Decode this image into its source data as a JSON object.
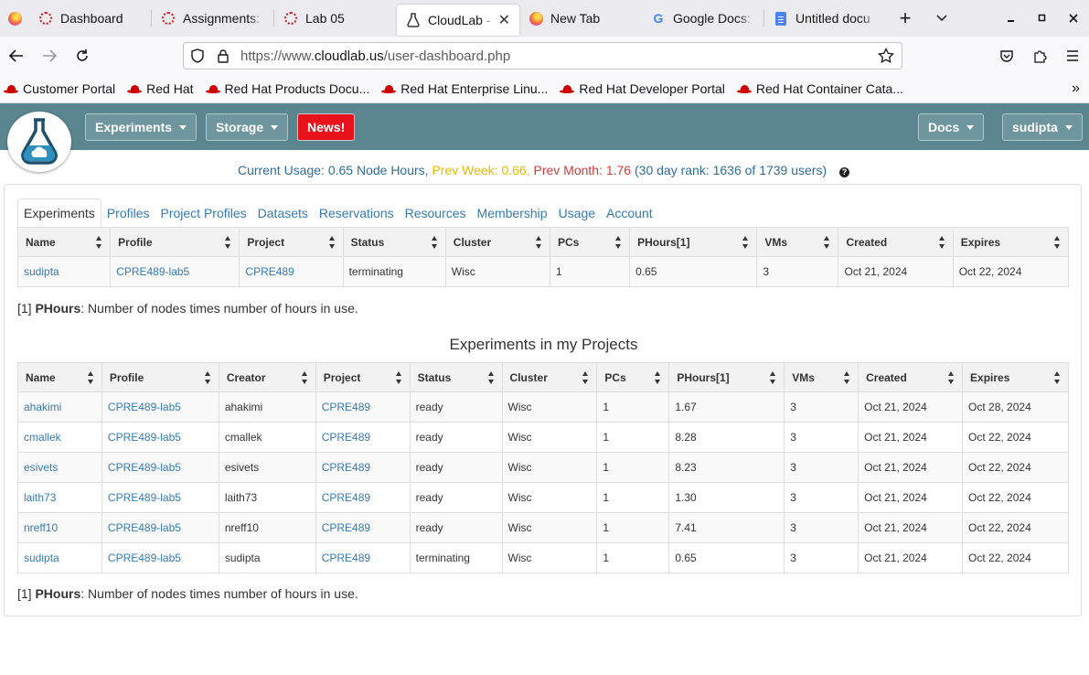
{
  "browser": {
    "tabs": [
      {
        "title": "Dashboard",
        "icon": "redhat-dotted-icon",
        "active": false
      },
      {
        "title": "Assignments: ",
        "icon": "redhat-dotted-icon",
        "active": false
      },
      {
        "title": "Lab 05",
        "icon": "redhat-dotted-icon",
        "active": false
      },
      {
        "title": "CloudLab - U",
        "icon": "cloudlab-icon",
        "active": true
      },
      {
        "title": "New Tab",
        "icon": "firefox-icon",
        "active": false
      },
      {
        "title": "Google Docs: ",
        "icon": "google-icon",
        "active": false
      },
      {
        "title": "Untitled docu",
        "icon": "docs-icon",
        "active": false
      }
    ],
    "url": {
      "prefix": "https://www.",
      "host": "cloudlab.us",
      "path": "/user-dashboard.php"
    },
    "bookmarks": [
      "Customer Portal",
      "Red Hat",
      "Red Hat Products Docu...",
      "Red Hat Enterprise Linu...",
      "Red Hat Developer Portal",
      "Red Hat Container Cata..."
    ]
  },
  "header": {
    "experiments_label": "Experiments",
    "storage_label": "Storage",
    "news_label": "News!",
    "docs_label": "Docs",
    "user_label": "sudipta",
    "colors": {
      "bar": "#5b868f",
      "news": "#e8121c"
    }
  },
  "usage": {
    "current": "Current Usage: 0.65 Node Hours,",
    "prev_week": "Prev Week: 0.66,",
    "prev_month": "Prev Month: 1.76",
    "rank": "(30 day rank: 1636 of 1739 users)"
  },
  "tabs": [
    "Experiments",
    "Profiles",
    "Project Profiles",
    "Datasets",
    "Reservations",
    "Resources",
    "Membership",
    "Usage",
    "Account"
  ],
  "my_experiments": {
    "columns": [
      "Name",
      "Profile",
      "Project",
      "Status",
      "Cluster",
      "PCs",
      "PHours[1]",
      "VMs",
      "Created",
      "Expires"
    ],
    "rows": [
      [
        "sudipta",
        "CPRE489-lab5",
        "CPRE489",
        "terminating",
        "Wisc",
        "1",
        "0.65",
        "3",
        "Oct 21, 2024",
        "Oct 22, 2024"
      ]
    ]
  },
  "footnote": {
    "prefix": "[1] ",
    "term": "PHours",
    "text": ": Number of nodes times number of hours in use."
  },
  "project_experiments": {
    "title": "Experiments in my Projects",
    "columns": [
      "Name",
      "Profile",
      "Creator",
      "Project",
      "Status",
      "Cluster",
      "PCs",
      "PHours[1]",
      "VMs",
      "Created",
      "Expires"
    ],
    "rows": [
      [
        "ahakimi",
        "CPRE489-lab5",
        "ahakimi",
        "CPRE489",
        "ready",
        "Wisc",
        "1",
        "1.67",
        "3",
        "Oct 21, 2024",
        "Oct 28, 2024"
      ],
      [
        "cmallek",
        "CPRE489-lab5",
        "cmallek",
        "CPRE489",
        "ready",
        "Wisc",
        "1",
        "8.28",
        "3",
        "Oct 21, 2024",
        "Oct 22, 2024"
      ],
      [
        "esivets",
        "CPRE489-lab5",
        "esivets",
        "CPRE489",
        "ready",
        "Wisc",
        "1",
        "8.23",
        "3",
        "Oct 21, 2024",
        "Oct 22, 2024"
      ],
      [
        "laith73",
        "CPRE489-lab5",
        "laith73",
        "CPRE489",
        "ready",
        "Wisc",
        "1",
        "1.30",
        "3",
        "Oct 21, 2024",
        "Oct 22, 2024"
      ],
      [
        "nreff10",
        "CPRE489-lab5",
        "nreff10",
        "CPRE489",
        "ready",
        "Wisc",
        "1",
        "7.41",
        "3",
        "Oct 21, 2024",
        "Oct 22, 2024"
      ],
      [
        "sudipta",
        "CPRE489-lab5",
        "sudipta",
        "CPRE489",
        "terminating",
        "Wisc",
        "1",
        "0.65",
        "3",
        "Oct 21, 2024",
        "Oct 22, 2024"
      ]
    ]
  }
}
